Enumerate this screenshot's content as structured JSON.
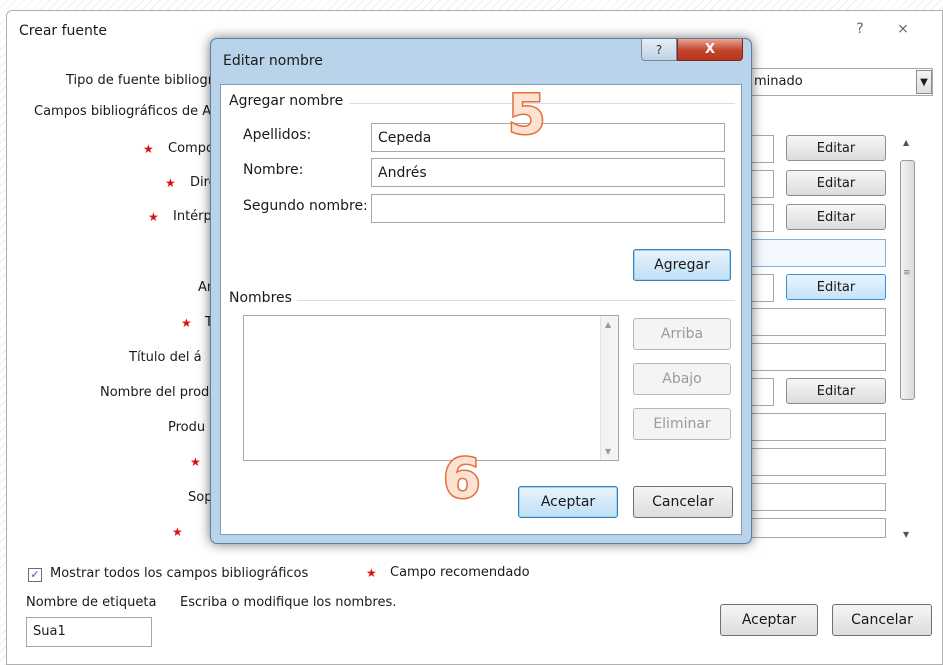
{
  "outer_dialog": {
    "title": "Crear fuente",
    "help_glyph": "?",
    "close_glyph": "⨯",
    "source_type_label": "Tipo de fuente bibliogr",
    "source_type_value": "minado",
    "fields_header": "Campos bibliográficos de AF",
    "left_labels": [
      "Compo",
      "Dire",
      "Intérp",
      "Ar",
      "T",
      "Título del á",
      "Nombre del produ",
      "Produ",
      "",
      "Sop",
      ""
    ],
    "edit_label": "Editar",
    "show_all_fields": "Mostrar todos los campos bibliográficos",
    "show_all_checked": true,
    "recommended_field": "Campo recomendado",
    "tag_name_label": "Nombre de etiqueta",
    "hint_text": "Escriba o modifique los nombres.",
    "tag_name_value": "Sua1",
    "ok_label": "Aceptar",
    "cancel_label": "Cancelar"
  },
  "inner_dialog": {
    "title": "Editar nombre",
    "help_glyph": "?",
    "close_glyph": "X",
    "add_name_group": "Agregar nombre",
    "surname_label": "Apellidos:",
    "surname_value": "Cepeda",
    "first_name_label": "Nombre:",
    "first_name_value": "Andrés",
    "middle_name_label": "Segundo nombre:",
    "middle_name_value": "",
    "add_button": "Agregar",
    "names_group": "Nombres",
    "up_button": "Arriba",
    "down_button": "Abajo",
    "delete_button": "Eliminar",
    "ok_button": "Aceptar",
    "cancel_button": "Cancelar"
  },
  "annotations": {
    "step_5": "5",
    "step_6": "6",
    "annotation_color": "#e46d3a"
  }
}
